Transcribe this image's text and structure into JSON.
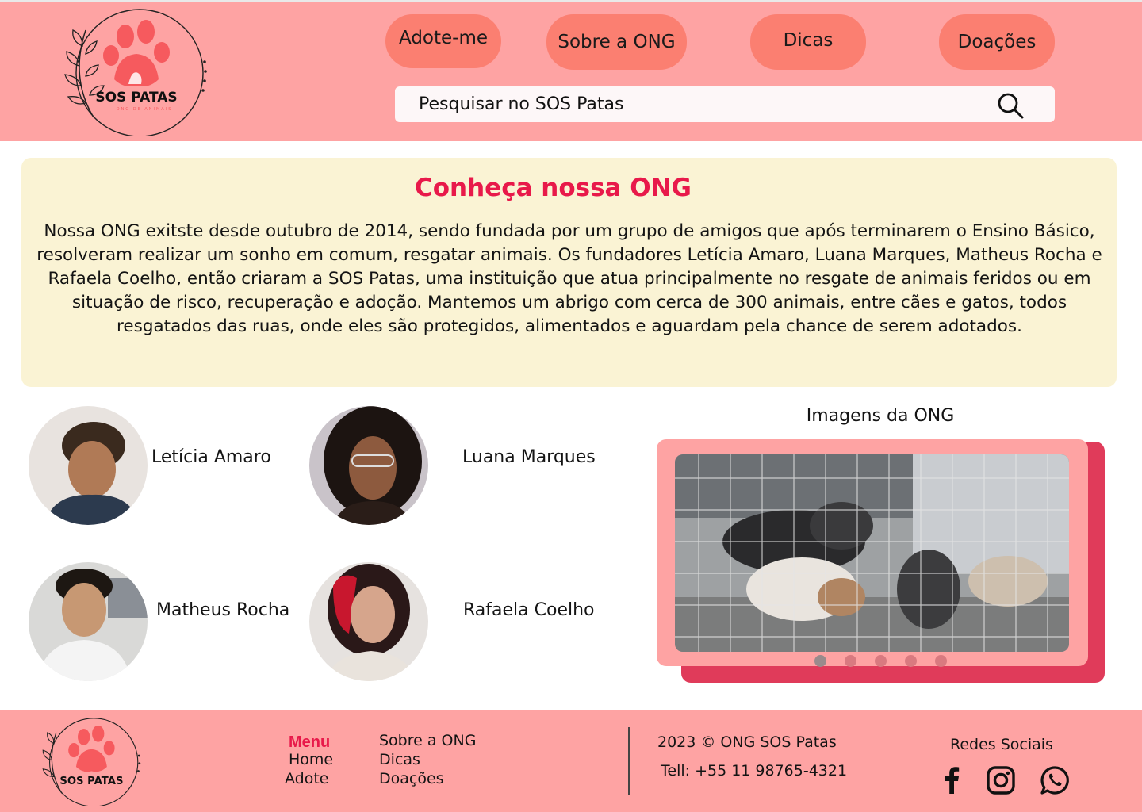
{
  "brand": {
    "name": "SOS PATAS",
    "tagline": "ONG DE ANIMAIS"
  },
  "nav": [
    {
      "label": "Adote-me"
    },
    {
      "label": "Sobre a ONG"
    },
    {
      "label": "Dicas"
    },
    {
      "label": "Doações"
    }
  ],
  "search": {
    "placeholder": "Pesquisar no SOS Patas"
  },
  "about": {
    "title": "Conheça nossa ONG",
    "text": "Nossa ONG exitste desde  outubro de 2014, sendo fundada por um grupo de amigos que após terminarem o Ensino Básico, resolveram realizar um sonho em comum, resgatar animais. Os fundadores Letícia Amaro, Luana Marques, Matheus Rocha e Rafaela Coelho, então criaram a SOS Patas, uma instituição que atua principalmente no resgate de animais feridos ou em situação de risco, recuperação e adoção. Mantemos um abrigo com cerca de 300 animais, entre cães e gatos, todos resgatados das ruas, onde eles são protegidos, alimentados e aguardam pela chance de serem adotados."
  },
  "founders": [
    {
      "name": "Letícia Amaro"
    },
    {
      "name": "Luana Marques"
    },
    {
      "name": "Matheus Rocha"
    },
    {
      "name": "Rafaela Coelho"
    }
  ],
  "gallery": {
    "title": "Imagens da ONG",
    "slide_count": 5,
    "active_slide": 1
  },
  "footer": {
    "menu_label": "Menu",
    "links_col1": [
      "Home",
      "Adote"
    ],
    "links_col2": [
      "Sobre a ONG",
      "Dicas",
      "Doações"
    ],
    "copyright": "2023 © ONG SOS Patas",
    "phone": "Tell: +55 11 98765-4321",
    "social_title": "Redes Sociais",
    "social_icons": [
      "facebook-icon",
      "instagram-icon",
      "whatsapp-icon"
    ]
  },
  "colors": {
    "header_bg": "#fea3a3",
    "nav_button": "#fb7f71",
    "accent": "#e8194a",
    "about_bg": "#faf3d4",
    "gallery_shadow": "#e03b5a"
  }
}
